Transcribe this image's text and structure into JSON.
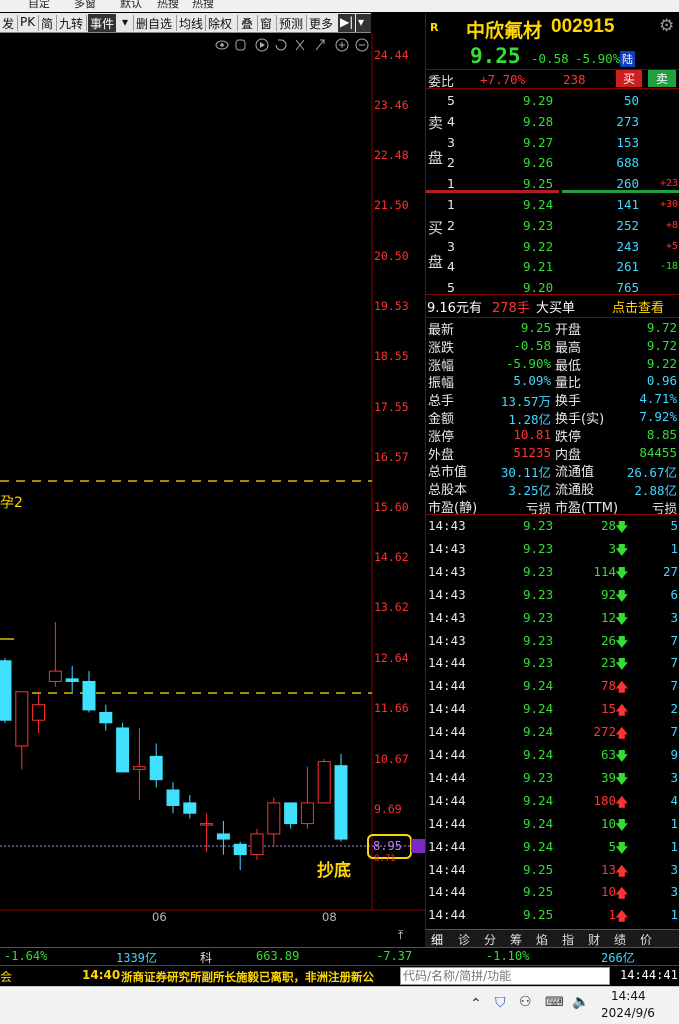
{
  "menubar": [
    "自定",
    "多窗",
    "默认",
    "热搜",
    "热搜"
  ],
  "toolbar": {
    "items": [
      "发",
      "PK",
      "简",
      "九转",
      "事件",
      "▾",
      "删自选",
      "均线",
      "除权",
      "叠",
      "窗",
      "预测",
      "更多",
      "▶|",
      "▾"
    ]
  },
  "chart": {
    "price_axis": [
      "24.44",
      "23.46",
      "22.48",
      "21.50",
      "20.50",
      "19.53",
      "18.55",
      "17.55",
      "16.57",
      "15.60",
      "14.62",
      "13.62",
      "12.64",
      "11.66",
      "10.67",
      "9.69",
      "8.71"
    ],
    "date_labels": [
      "06",
      "08"
    ],
    "current_price_label": "8.95",
    "annotation_left": "孕2",
    "annotation_bottom": "抄底",
    "bull_color": "#ff3030",
    "bear_color": "#40e0ff"
  },
  "chart_data": {
    "type": "candlestick",
    "ylim": [
      8.71,
      24.44
    ],
    "candles": [
      {
        "o": 12.7,
        "h": 12.75,
        "l": 11.5,
        "c": 11.55
      },
      {
        "o": 11.05,
        "h": 12.1,
        "l": 10.6,
        "c": 12.1
      },
      {
        "o": 11.55,
        "h": 12.1,
        "l": 11.3,
        "c": 11.85
      },
      {
        "o": 12.3,
        "h": 13.45,
        "l": 12.2,
        "c": 12.5
      },
      {
        "o": 12.35,
        "h": 12.6,
        "l": 12.1,
        "c": 12.3
      },
      {
        "o": 12.3,
        "h": 12.5,
        "l": 11.7,
        "c": 11.75
      },
      {
        "o": 11.7,
        "h": 11.85,
        "l": 11.35,
        "c": 11.5
      },
      {
        "o": 11.4,
        "h": 11.5,
        "l": 10.6,
        "c": 10.55
      },
      {
        "o": 10.6,
        "h": 11.4,
        "l": 10.0,
        "c": 10.65
      },
      {
        "o": 10.85,
        "h": 11.1,
        "l": 10.25,
        "c": 10.4
      },
      {
        "o": 10.2,
        "h": 10.35,
        "l": 9.75,
        "c": 9.9
      },
      {
        "o": 9.95,
        "h": 10.1,
        "l": 9.65,
        "c": 9.75
      },
      {
        "o": 9.55,
        "h": 9.75,
        "l": 9.0,
        "c": 9.55
      },
      {
        "o": 9.35,
        "h": 9.6,
        "l": 8.95,
        "c": 9.25
      },
      {
        "o": 9.15,
        "h": 9.2,
        "l": 8.65,
        "c": 8.95
      },
      {
        "o": 8.95,
        "h": 9.45,
        "l": 8.85,
        "c": 9.35
      },
      {
        "o": 9.35,
        "h": 10.05,
        "l": 9.1,
        "c": 9.95
      },
      {
        "o": 9.95,
        "h": 9.95,
        "l": 9.45,
        "c": 9.55
      },
      {
        "o": 9.55,
        "h": 10.65,
        "l": 9.45,
        "c": 9.95
      },
      {
        "o": 9.95,
        "h": 10.8,
        "l": 9.95,
        "c": 10.75
      },
      {
        "o": 10.67,
        "h": 10.9,
        "l": 9.2,
        "c": 9.25
      }
    ]
  },
  "quote": {
    "code_tag": "R",
    "stock_name": "中欣氟材",
    "stock_code": "002915",
    "price": "9.25",
    "change": "-0.58",
    "change_pct": "-5.90%",
    "exchange_badge": "陆",
    "weibi_label": "委比",
    "weibi_value": "+7.70%",
    "weibi_diff": "238",
    "buy_btn": "买",
    "sell_btn": "卖",
    "sell_side_label": [
      "卖",
      "盘"
    ],
    "buy_side_label": [
      "买",
      "盘"
    ],
    "asks": [
      {
        "lvl": "5",
        "price": "9.29",
        "vol": "50",
        "chg": ""
      },
      {
        "lvl": "4",
        "price": "9.28",
        "vol": "273",
        "chg": ""
      },
      {
        "lvl": "3",
        "price": "9.27",
        "vol": "153",
        "chg": ""
      },
      {
        "lvl": "2",
        "price": "9.26",
        "vol": "688",
        "chg": ""
      },
      {
        "lvl": "1",
        "price": "9.25",
        "vol": "260",
        "chg": "+23"
      }
    ],
    "bids": [
      {
        "lvl": "1",
        "price": "9.24",
        "vol": "141",
        "chg": "+30"
      },
      {
        "lvl": "2",
        "price": "9.23",
        "vol": "252",
        "chg": "+8"
      },
      {
        "lvl": "3",
        "price": "9.22",
        "vol": "243",
        "chg": "+5"
      },
      {
        "lvl": "4",
        "price": "9.21",
        "vol": "261",
        "chg": "-18"
      },
      {
        "lvl": "5",
        "price": "9.20",
        "vol": "765",
        "chg": ""
      }
    ],
    "big_order": {
      "a": "9.16元有",
      "b": "278手",
      "c": "大买单",
      "d": "点击查看"
    },
    "stats": [
      [
        "最新",
        "9.25",
        "开盘",
        "9.72"
      ],
      [
        "涨跌",
        "-0.58",
        "最高",
        "9.72"
      ],
      [
        "涨幅",
        "-5.90%",
        "最低",
        "9.22"
      ],
      [
        "振幅",
        "5.09%",
        "量比",
        "0.96"
      ],
      [
        "总手",
        "13.57万",
        "换手",
        "4.71%"
      ],
      [
        "金额",
        "1.28亿",
        "换手(实)",
        "7.92%"
      ],
      [
        "涨停",
        "10.81",
        "跌停",
        "8.85"
      ],
      [
        "外盘",
        "51235",
        "内盘",
        "84455"
      ],
      [
        "总市值",
        "30.11亿",
        "流通值",
        "26.67亿"
      ],
      [
        "总股本",
        "3.25亿",
        "流通股",
        "2.88亿"
      ],
      [
        "市盈(静)",
        "亏损",
        "市盈(TTM)",
        "亏损"
      ]
    ],
    "ticks": [
      {
        "t": "14:43",
        "p": "9.23",
        "v": "28",
        "d": "down",
        "n": "5"
      },
      {
        "t": "14:43",
        "p": "9.23",
        "v": "3",
        "d": "down",
        "n": "1"
      },
      {
        "t": "14:43",
        "p": "9.23",
        "v": "114",
        "d": "down",
        "n": "27"
      },
      {
        "t": "14:43",
        "p": "9.23",
        "v": "92",
        "d": "down",
        "n": "6"
      },
      {
        "t": "14:43",
        "p": "9.23",
        "v": "12",
        "d": "down",
        "n": "3"
      },
      {
        "t": "14:43",
        "p": "9.23",
        "v": "26",
        "d": "down",
        "n": "7"
      },
      {
        "t": "14:44",
        "p": "9.23",
        "v": "23",
        "d": "down",
        "n": "7"
      },
      {
        "t": "14:44",
        "p": "9.24",
        "v": "78",
        "d": "up",
        "n": "7"
      },
      {
        "t": "14:44",
        "p": "9.24",
        "v": "15",
        "d": "up",
        "n": "2"
      },
      {
        "t": "14:44",
        "p": "9.24",
        "v": "272",
        "d": "up",
        "n": "7"
      },
      {
        "t": "14:44",
        "p": "9.24",
        "v": "63",
        "d": "down",
        "n": "9"
      },
      {
        "t": "14:44",
        "p": "9.23",
        "v": "39",
        "d": "down",
        "n": "3"
      },
      {
        "t": "14:44",
        "p": "9.24",
        "v": "180",
        "d": "up",
        "n": "4"
      },
      {
        "t": "14:44",
        "p": "9.24",
        "v": "10",
        "d": "down",
        "n": "1"
      },
      {
        "t": "14:44",
        "p": "9.24",
        "v": "5",
        "d": "down",
        "n": "1"
      },
      {
        "t": "14:44",
        "p": "9.25",
        "v": "13",
        "d": "up",
        "n": "3"
      },
      {
        "t": "14:44",
        "p": "9.25",
        "v": "10",
        "d": "up",
        "n": "3"
      },
      {
        "t": "14:44",
        "p": "9.25",
        "v": "1",
        "d": "up",
        "n": "1"
      }
    ]
  },
  "bottom_tabs": [
    "细",
    "诊",
    "分",
    "筹",
    "焰",
    "指",
    "财",
    "绩",
    "价"
  ],
  "statusbar": {
    "a": "-1.64%",
    "b": "1339亿",
    "c": "科",
    "d": "663.89",
    "e": "-7.37",
    "f": "-1.10%",
    "g": "266亿"
  },
  "newsbar": {
    "left": "会",
    "time": "14:40",
    "text": "浙商证券研究所副所长施毅已离职，非洲注册新公",
    "search_placeholder": "代码/名称/简拼/功能",
    "clock": "14:44:41"
  },
  "taskbar": {
    "time": "14:44",
    "date": "2024/9/6"
  }
}
